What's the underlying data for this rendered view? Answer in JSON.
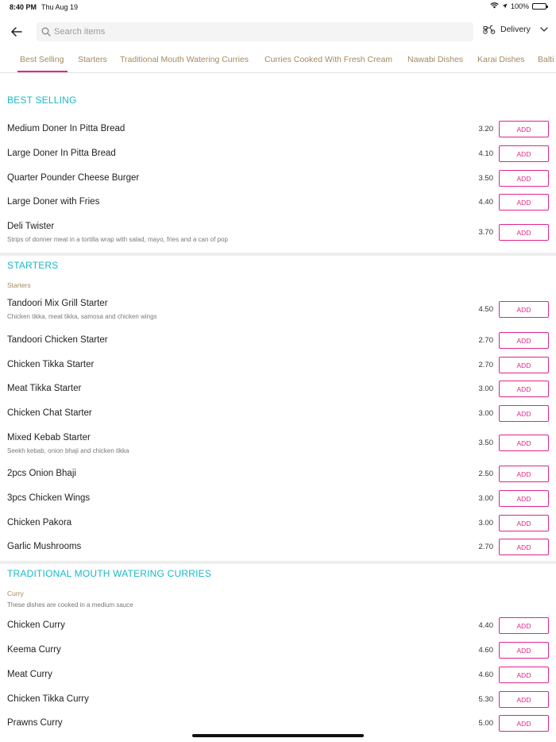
{
  "status_bar": {
    "time": "8:40 PM",
    "date": "Thu Aug 19",
    "battery": "100%"
  },
  "search": {
    "placeholder": "Search items"
  },
  "delivery": {
    "label": "Delivery"
  },
  "tabs": [
    {
      "label": "Best Selling",
      "active": true
    },
    {
      "label": "Starters"
    },
    {
      "label": "Traditional Mouth Watering Curries"
    },
    {
      "label": "Curries Cooked With Fresh Cream"
    },
    {
      "label": "Nawabi Dishes"
    },
    {
      "label": "Karai Dishes"
    },
    {
      "label": "Balti"
    }
  ],
  "add_label": "ADD",
  "sections": [
    {
      "title": "BEST SELLING",
      "items": [
        {
          "name": "Medium Doner In Pitta Bread",
          "price": "3.20"
        },
        {
          "name": "Large Doner In Pitta Bread",
          "price": "4.10"
        },
        {
          "name": "Quarter Pounder Cheese Burger",
          "price": "3.50"
        },
        {
          "name": "Large Doner with Fries",
          "price": "4.40"
        },
        {
          "name": "Deli Twister",
          "desc": "Strips of donner meat in a tortilla wrap with salad, mayo, fries and a can of pop",
          "price": "3.70"
        }
      ]
    },
    {
      "title": "STARTERS",
      "subtitle": "Starters",
      "items": [
        {
          "name": "Tandoori Mix Grill Starter",
          "desc": "Chicken tikka, meat tikka, samosa and chicken wings",
          "price": "4.50"
        },
        {
          "name": "Tandoori Chicken Starter",
          "price": "2.70"
        },
        {
          "name": "Chicken Tikka Starter",
          "price": "2.70"
        },
        {
          "name": "Meat Tikka Starter",
          "price": "3.00"
        },
        {
          "name": "Chicken Chat Starter",
          "price": "3.00"
        },
        {
          "name": "Mixed Kebab Starter",
          "desc": "Seekh kebab, onion bhaji and chicken tikka",
          "price": "3.50"
        },
        {
          "name": "2pcs Onion Bhaji",
          "price": "2.50"
        },
        {
          "name": "3pcs Chicken Wings",
          "price": "3.00"
        },
        {
          "name": "Chicken Pakora",
          "price": "3.00"
        },
        {
          "name": "Garlic Mushrooms",
          "price": "2.70"
        }
      ]
    },
    {
      "title": "TRADITIONAL MOUTH WATERING CURRIES",
      "subtitle": "Curry",
      "subtitle_desc": "These dishes are cooked in a medium sauce",
      "items": [
        {
          "name": "Chicken Curry",
          "price": "4.40"
        },
        {
          "name": "Keema Curry",
          "price": "4.60"
        },
        {
          "name": "Meat Curry",
          "price": "4.60"
        },
        {
          "name": "Chicken Tikka Curry",
          "price": "5.30"
        },
        {
          "name": "Prawns Curry",
          "price": "5.00"
        }
      ]
    }
  ],
  "colors": {
    "accent": "#e0258f",
    "section": "#1ab8c4",
    "tab": "#a48a5e"
  }
}
